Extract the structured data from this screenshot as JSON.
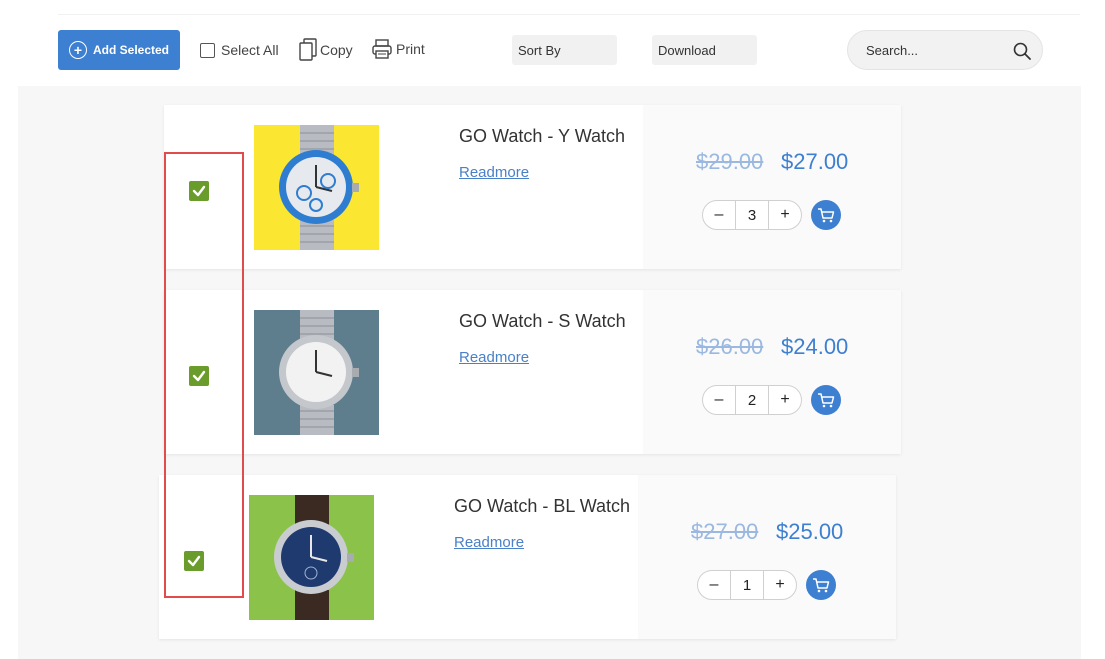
{
  "toolbar": {
    "add_selected_label": "Add Selected",
    "select_all_label": "Select All",
    "copy_label": "Copy",
    "print_label": "Print",
    "sort_label": "Sort By",
    "download_label": "Download",
    "search_placeholder": "Search..."
  },
  "products": [
    {
      "name": "GO Watch - Y Watch",
      "readmore": "Readmore",
      "old_price": "$29.00",
      "price": "$27.00",
      "qty": "3",
      "checked": true,
      "bg_color": "#fbe731",
      "dial_color": "#e6eaee"
    },
    {
      "name": "GO Watch - S Watch",
      "readmore": "Readmore",
      "old_price": "$26.00",
      "price": "$24.00",
      "qty": "2",
      "checked": true,
      "bg_color": "#5e7e8e",
      "dial_color": "#f2f2f2"
    },
    {
      "name": "GO Watch - BL Watch",
      "readmore": "Readmore",
      "old_price": "$27.00",
      "price": "$25.00",
      "qty": "1",
      "checked": true,
      "bg_color": "#8bc34a",
      "dial_color": "#1e3a6e"
    }
  ],
  "qty_controls": {
    "minus": "–",
    "plus": "+"
  },
  "colors": {
    "accent": "#3d7fd0",
    "checkbox": "#6a9c2c",
    "highlight": "#e24b4b"
  }
}
